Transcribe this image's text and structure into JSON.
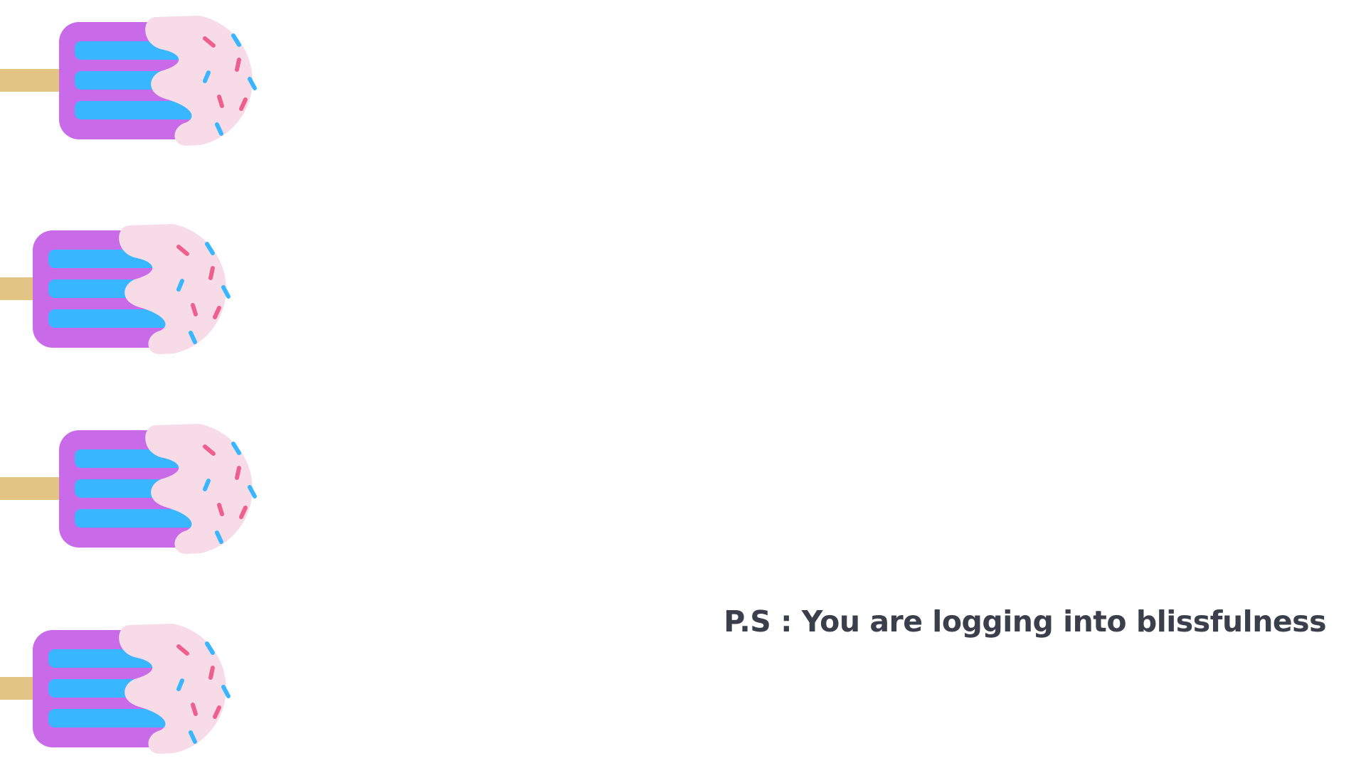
{
  "note": {
    "text": "P.S : You are logging into blissfulness"
  },
  "decorations": {
    "popsicle_icon": "popsicle-icon",
    "count": 4
  },
  "colors": {
    "background": "#ffffff",
    "stick": "#e2c585",
    "popsicle_body": "#c96ae8",
    "stripes": "#38b6ff",
    "icing": "#f7dbe7",
    "sprinkle_pink": "#ef5f8e",
    "sprinkle_blue": "#38b6ff",
    "text": "#3a3f4b"
  }
}
